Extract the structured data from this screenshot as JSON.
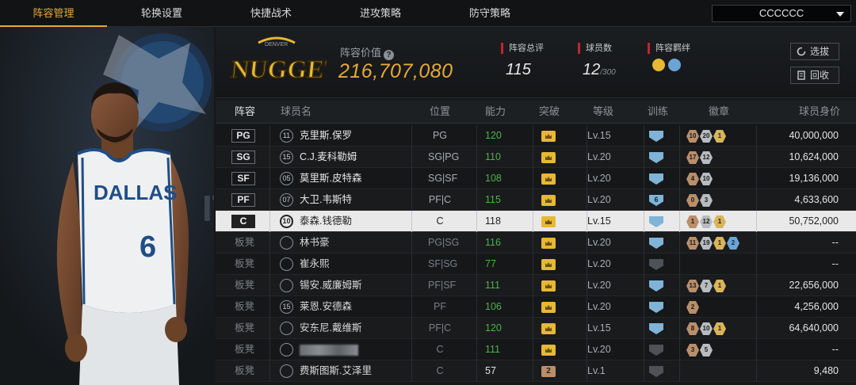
{
  "nav": {
    "tabs": [
      "阵容管理",
      "轮换设置",
      "快捷战术",
      "进攻策略",
      "防守策略"
    ],
    "active_tab": "阵容管理",
    "team_select": "CCCCCC"
  },
  "header": {
    "logo_text": "NUGGETS",
    "lineup_value_label": "阵容价值",
    "lineup_value": "216,707,080",
    "stats": [
      {
        "label": "阵容总评",
        "value": "115",
        "suffix": ""
      },
      {
        "label": "球员数",
        "value": "12",
        "suffix": "/300"
      },
      {
        "label": "阵容羁绊",
        "value": "",
        "suffix": ""
      }
    ],
    "buttons": {
      "select": "选拔",
      "recycle": "回收"
    }
  },
  "player_art": {
    "jersey_text": "DALLAS",
    "jersey_number": "6"
  },
  "table": {
    "headers": [
      "阵容",
      "球员名",
      "位置",
      "能力",
      "突破",
      "等级",
      "训练",
      "徽章",
      "球员身价"
    ],
    "rows": [
      {
        "slot": "PG",
        "num": "11",
        "name": "克里斯.保罗",
        "pos": "PG",
        "ability": "120",
        "level": "Lv.15",
        "train": "",
        "worth": "40,000,000"
      },
      {
        "slot": "SG",
        "num": "15",
        "name": "C.J.麦科勒姆",
        "pos": "SG|PG",
        "ability": "110",
        "level": "Lv.20",
        "train": "",
        "worth": "10,624,000"
      },
      {
        "slot": "SF",
        "num": "05",
        "name": "莫里斯.皮特森",
        "pos": "SG|SF",
        "ability": "108",
        "level": "Lv.20",
        "train": "",
        "worth": "19,136,000"
      },
      {
        "slot": "PF",
        "num": "07",
        "name": "大卫.韦斯特",
        "pos": "PF|C",
        "ability": "115",
        "level": "Lv.20",
        "train": "6",
        "worth": "4,633,600"
      },
      {
        "slot": "C",
        "num": "10",
        "name": "泰森.钱德勒",
        "pos": "C",
        "ability": "118",
        "level": "Lv.15",
        "train": "",
        "worth": "50,752,000"
      },
      {
        "slot": "板凳",
        "num": "",
        "name": "林书豪",
        "pos": "PG|SG",
        "ability": "116",
        "level": "Lv.20",
        "train": "",
        "worth": "--"
      },
      {
        "slot": "板凳",
        "num": "",
        "name": "崔永熙",
        "pos": "SF|SG",
        "ability": "77",
        "level": "Lv.20",
        "train": "",
        "worth": "--"
      },
      {
        "slot": "板凳",
        "num": "",
        "name": "锡安.威廉姆斯",
        "pos": "PF|SF",
        "ability": "111",
        "level": "Lv.20",
        "train": "",
        "worth": "22,656,000"
      },
      {
        "slot": "板凳",
        "num": "15",
        "name": "莱恩.安德森",
        "pos": "PF",
        "ability": "106",
        "level": "Lv.20",
        "train": "",
        "worth": "4,256,000"
      },
      {
        "slot": "板凳",
        "num": "",
        "name": "安东尼.戴维斯",
        "pos": "PF|C",
        "ability": "120",
        "level": "Lv.15",
        "train": "",
        "worth": "64,640,000"
      },
      {
        "slot": "板凳",
        "num": "",
        "name": "",
        "pos": "C",
        "ability": "111",
        "level": "Lv.20",
        "train": "",
        "worth": "--"
      },
      {
        "slot": "板凳",
        "num": "",
        "name": "费斯图斯.艾泽里",
        "pos": "C",
        "ability": "57",
        "level": "Lv.1",
        "train": "",
        "worth": "9,480",
        "break": "2"
      }
    ],
    "badges": [
      [
        "10",
        "20",
        "1"
      ],
      [
        "17",
        "12"
      ],
      [
        "4",
        "10"
      ],
      [
        "0",
        "3"
      ],
      [
        "1",
        "12",
        "1"
      ],
      [
        "11",
        "19",
        "1",
        "2"
      ],
      [],
      [
        "13",
        "7",
        "1"
      ],
      [
        "2"
      ],
      [
        "8",
        "10",
        "1"
      ],
      [
        "3",
        "5"
      ],
      []
    ]
  }
}
